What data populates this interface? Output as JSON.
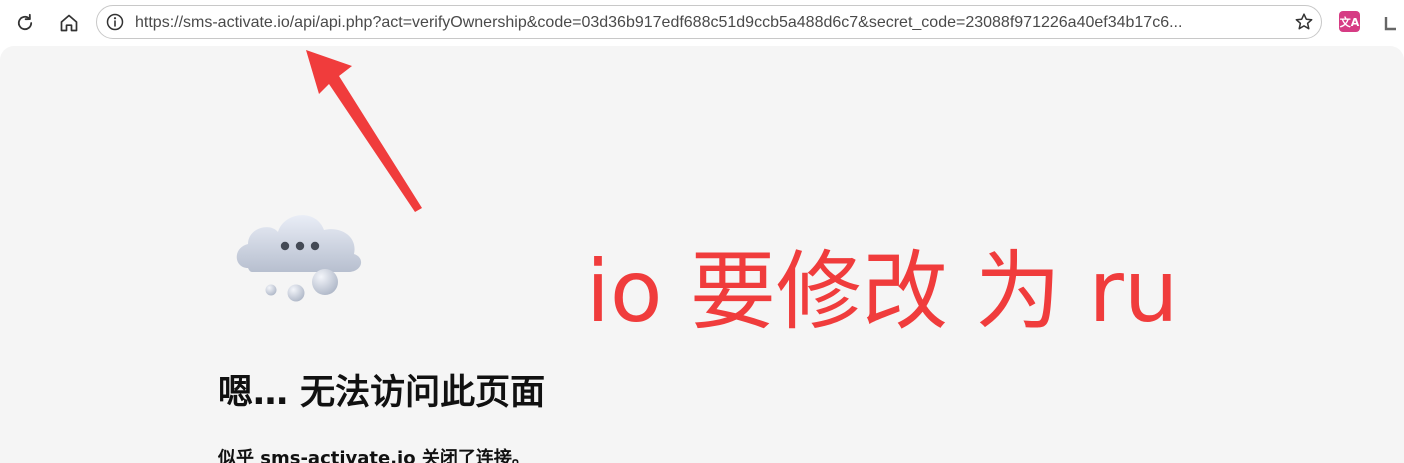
{
  "toolbar": {
    "reload_icon": "reload-icon",
    "home_icon": "home-icon",
    "info_icon": "info-icon",
    "url": "https://sms-activate.io/api/api.php?act=verifyOwnership&code=03d36b917edf688c51d9ccb5a488d6c7&secret_code=23088f971226a40ef34b17c6...",
    "star_icon": "star-icon",
    "translate_label": "文A",
    "translate_color": "#d63c84"
  },
  "page": {
    "heading": "嗯… 无法访问此页面",
    "subtext": "似乎 sms-activate.io 关闭了连接。",
    "cloud_icon": "cloud-error-icon"
  },
  "annotation": {
    "text": "io 要修改 为 ru",
    "color": "#f03c3c"
  }
}
